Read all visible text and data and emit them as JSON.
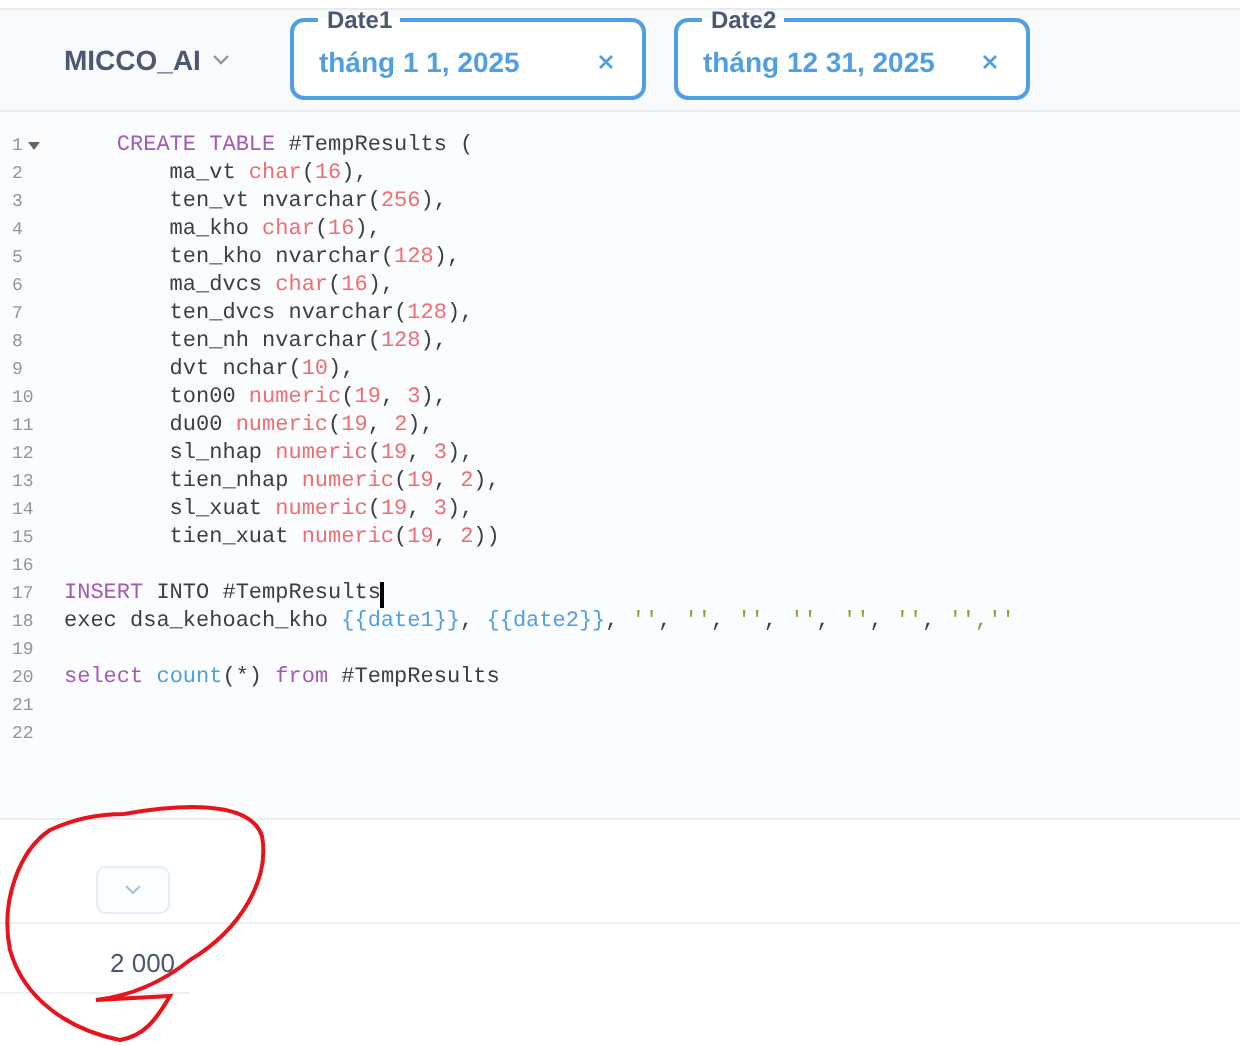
{
  "header": {
    "database": "MICCO_AI",
    "filters": [
      {
        "label": "Date1",
        "value": "tháng 1 1, 2025"
      },
      {
        "label": "Date2",
        "value": "tháng 12 31, 2025"
      }
    ]
  },
  "editor": {
    "lines": [
      {
        "number": "1",
        "foldable": true,
        "cursor": false,
        "tokens": [
          {
            "text": "    CREATE TABLE",
            "kind": "keyword"
          },
          {
            "text": " #TempResults (",
            "kind": "plain"
          }
        ]
      },
      {
        "number": "2",
        "foldable": false,
        "cursor": false,
        "tokens": [
          {
            "text": "        ma_vt ",
            "kind": "plain"
          },
          {
            "text": "char",
            "kind": "type"
          },
          {
            "text": "(",
            "kind": "plain"
          },
          {
            "text": "16",
            "kind": "number"
          },
          {
            "text": "),",
            "kind": "plain"
          }
        ]
      },
      {
        "number": "3",
        "foldable": false,
        "cursor": false,
        "tokens": [
          {
            "text": "        ten_vt nvarchar(",
            "kind": "plain"
          },
          {
            "text": "256",
            "kind": "number"
          },
          {
            "text": "),",
            "kind": "plain"
          }
        ]
      },
      {
        "number": "4",
        "foldable": false,
        "cursor": false,
        "tokens": [
          {
            "text": "        ma_kho ",
            "kind": "plain"
          },
          {
            "text": "char",
            "kind": "type"
          },
          {
            "text": "(",
            "kind": "plain"
          },
          {
            "text": "16",
            "kind": "number"
          },
          {
            "text": "),",
            "kind": "plain"
          }
        ]
      },
      {
        "number": "5",
        "foldable": false,
        "cursor": false,
        "tokens": [
          {
            "text": "        ten_kho nvarchar(",
            "kind": "plain"
          },
          {
            "text": "128",
            "kind": "number"
          },
          {
            "text": "),",
            "kind": "plain"
          }
        ]
      },
      {
        "number": "6",
        "foldable": false,
        "cursor": false,
        "tokens": [
          {
            "text": "        ma_dvcs ",
            "kind": "plain"
          },
          {
            "text": "char",
            "kind": "type"
          },
          {
            "text": "(",
            "kind": "plain"
          },
          {
            "text": "16",
            "kind": "number"
          },
          {
            "text": "),",
            "kind": "plain"
          }
        ]
      },
      {
        "number": "7",
        "foldable": false,
        "cursor": false,
        "tokens": [
          {
            "text": "        ten_dvcs nvarchar(",
            "kind": "plain"
          },
          {
            "text": "128",
            "kind": "number"
          },
          {
            "text": "),",
            "kind": "plain"
          }
        ]
      },
      {
        "number": "8",
        "foldable": false,
        "cursor": false,
        "tokens": [
          {
            "text": "        ten_nh nvarchar(",
            "kind": "plain"
          },
          {
            "text": "128",
            "kind": "number"
          },
          {
            "text": "),",
            "kind": "plain"
          }
        ]
      },
      {
        "number": "9",
        "foldable": false,
        "cursor": false,
        "tokens": [
          {
            "text": "        dvt nchar(",
            "kind": "plain"
          },
          {
            "text": "10",
            "kind": "number"
          },
          {
            "text": "),",
            "kind": "plain"
          }
        ]
      },
      {
        "number": "10",
        "foldable": false,
        "cursor": false,
        "tokens": [
          {
            "text": "        ton00 ",
            "kind": "plain"
          },
          {
            "text": "numeric",
            "kind": "type"
          },
          {
            "text": "(",
            "kind": "plain"
          },
          {
            "text": "19",
            "kind": "number"
          },
          {
            "text": ", ",
            "kind": "plain"
          },
          {
            "text": "3",
            "kind": "number"
          },
          {
            "text": "),",
            "kind": "plain"
          }
        ]
      },
      {
        "number": "11",
        "foldable": false,
        "cursor": false,
        "tokens": [
          {
            "text": "        du00 ",
            "kind": "plain"
          },
          {
            "text": "numeric",
            "kind": "type"
          },
          {
            "text": "(",
            "kind": "plain"
          },
          {
            "text": "19",
            "kind": "number"
          },
          {
            "text": ", ",
            "kind": "plain"
          },
          {
            "text": "2",
            "kind": "number"
          },
          {
            "text": "),",
            "kind": "plain"
          }
        ]
      },
      {
        "number": "12",
        "foldable": false,
        "cursor": false,
        "tokens": [
          {
            "text": "        sl_nhap ",
            "kind": "plain"
          },
          {
            "text": "numeric",
            "kind": "type"
          },
          {
            "text": "(",
            "kind": "plain"
          },
          {
            "text": "19",
            "kind": "number"
          },
          {
            "text": ", ",
            "kind": "plain"
          },
          {
            "text": "3",
            "kind": "number"
          },
          {
            "text": "),",
            "kind": "plain"
          }
        ]
      },
      {
        "number": "13",
        "foldable": false,
        "cursor": false,
        "tokens": [
          {
            "text": "        tien_nhap ",
            "kind": "plain"
          },
          {
            "text": "numeric",
            "kind": "type"
          },
          {
            "text": "(",
            "kind": "plain"
          },
          {
            "text": "19",
            "kind": "number"
          },
          {
            "text": ", ",
            "kind": "plain"
          },
          {
            "text": "2",
            "kind": "number"
          },
          {
            "text": "),",
            "kind": "plain"
          }
        ]
      },
      {
        "number": "14",
        "foldable": false,
        "cursor": false,
        "tokens": [
          {
            "text": "        sl_xuat ",
            "kind": "plain"
          },
          {
            "text": "numeric",
            "kind": "type"
          },
          {
            "text": "(",
            "kind": "plain"
          },
          {
            "text": "19",
            "kind": "number"
          },
          {
            "text": ", ",
            "kind": "plain"
          },
          {
            "text": "3",
            "kind": "number"
          },
          {
            "text": "),",
            "kind": "plain"
          }
        ]
      },
      {
        "number": "15",
        "foldable": false,
        "cursor": false,
        "tokens": [
          {
            "text": "        tien_xuat ",
            "kind": "plain"
          },
          {
            "text": "numeric",
            "kind": "type"
          },
          {
            "text": "(",
            "kind": "plain"
          },
          {
            "text": "19",
            "kind": "number"
          },
          {
            "text": ", ",
            "kind": "plain"
          },
          {
            "text": "2",
            "kind": "number"
          },
          {
            "text": "))",
            "kind": "plain"
          }
        ]
      },
      {
        "number": "16",
        "foldable": false,
        "cursor": false
      },
      {
        "number": "17",
        "foldable": false,
        "cursor": true,
        "tokens": [
          {
            "text": "INSERT",
            "kind": "keyword"
          },
          {
            "text": " INTO #TempResults",
            "kind": "plain"
          }
        ]
      },
      {
        "number": "18",
        "foldable": false,
        "cursor": false,
        "tokens": [
          {
            "text": "exec dsa_kehoach_kho ",
            "kind": "plain"
          },
          {
            "text": "{{date1}}",
            "kind": "variable"
          },
          {
            "text": ", ",
            "kind": "plain"
          },
          {
            "text": "{{date2}}",
            "kind": "variable"
          },
          {
            "text": ", ",
            "kind": "plain"
          },
          {
            "text": "''",
            "kind": "string"
          },
          {
            "text": ", ",
            "kind": "plain"
          },
          {
            "text": "''",
            "kind": "string"
          },
          {
            "text": ", ",
            "kind": "plain"
          },
          {
            "text": "''",
            "kind": "string"
          },
          {
            "text": ", ",
            "kind": "plain"
          },
          {
            "text": "''",
            "kind": "string"
          },
          {
            "text": ", ",
            "kind": "plain"
          },
          {
            "text": "''",
            "kind": "string"
          },
          {
            "text": ", ",
            "kind": "plain"
          },
          {
            "text": "''",
            "kind": "string"
          },
          {
            "text": ", ",
            "kind": "plain"
          },
          {
            "text": "'',''",
            "kind": "string"
          }
        ]
      },
      {
        "number": "19",
        "foldable": false,
        "cursor": false
      },
      {
        "number": "20",
        "foldable": false,
        "cursor": false,
        "tokens": [
          {
            "text": "select ",
            "kind": "keyword"
          },
          {
            "text": "count",
            "kind": "function"
          },
          {
            "text": "(*) ",
            "kind": "plain"
          },
          {
            "text": "from",
            "kind": "keyword"
          },
          {
            "text": " #TempResults",
            "kind": "plain"
          }
        ]
      },
      {
        "number": "21",
        "foldable": false,
        "cursor": false
      },
      {
        "number": "22",
        "foldable": false,
        "cursor": false
      }
    ]
  },
  "result": {
    "value": "2 000"
  }
}
